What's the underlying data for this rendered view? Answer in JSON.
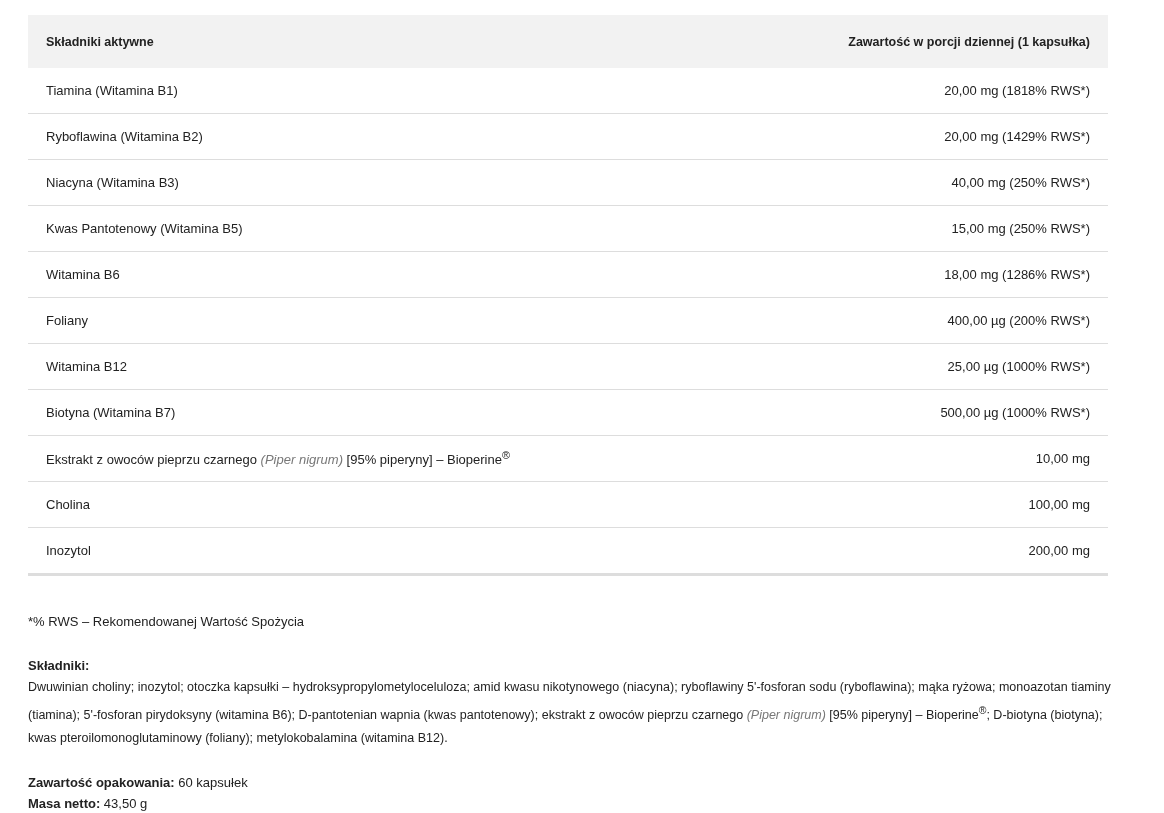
{
  "table": {
    "columns": [
      "Składniki aktywne",
      "Zawartość w porcji dziennej (1 kapsułka)"
    ],
    "rows": [
      {
        "name": "Tiamina (Witamina B1)",
        "amount": "20,00 mg (1818% RWS*)"
      },
      {
        "name": "Ryboflawina (Witamina B2)",
        "amount": "20,00 mg (1429% RWS*)"
      },
      {
        "name": "Niacyna (Witamina B3)",
        "amount": "40,00 mg (250% RWS*)"
      },
      {
        "name": "Kwas Pantotenowy (Witamina B5)",
        "amount": "15,00 mg (250% RWS*)"
      },
      {
        "name": "Witamina B6",
        "amount": "18,00 mg (1286% RWS*)"
      },
      {
        "name": "Foliany",
        "amount": "400,00 µg (200% RWS*)"
      },
      {
        "name": "Witamina B12",
        "amount": "25,00 µg (1000% RWS*)"
      },
      {
        "name": "Biotyna (Witamina B7)",
        "amount": "500,00 µg (1000% RWS*)"
      },
      {
        "name": "Ekstrakt z owoców pieprzu czarnego *(Piper nigrum)* [95% piperyny] – Bioperine$^{®}$",
        "amount": "10,00 mg"
      },
      {
        "name": "Cholina",
        "amount": "100,00 mg"
      },
      {
        "name": "Inozytol",
        "amount": "200,00 mg"
      }
    ]
  },
  "footnote": "*% RWS – Rekomendowanej Wartość Spożycia",
  "ingredients": {
    "heading": "Składniki:",
    "text": "Dwuwinian choliny; inozytol; otoczka kapsułki – hydroksypropylometyloceluloza; amid kwasu nikotynowego (niacyna); ryboflawiny 5'-fosforan sodu (ryboflawina); mąka ryżowa; monoazotan tiaminy (tiamina); 5'-fosforan pirydoksyny (witamina B6); D-pantotenian wapnia (kwas pantotenowy); ekstrakt z owoców pieprzu czarnego *(Piper nigrum)* [95% piperyny] – Bioperine$^{®}$; D-biotyna (biotyna); kwas pteroilomonoglutaminowy (foliany); metylokobalamina (witamina B12)."
  },
  "package": [
    "**Zawartość opakowania:** 60 kapsułek",
    "**Masa netto:** 43,50 g"
  ]
}
